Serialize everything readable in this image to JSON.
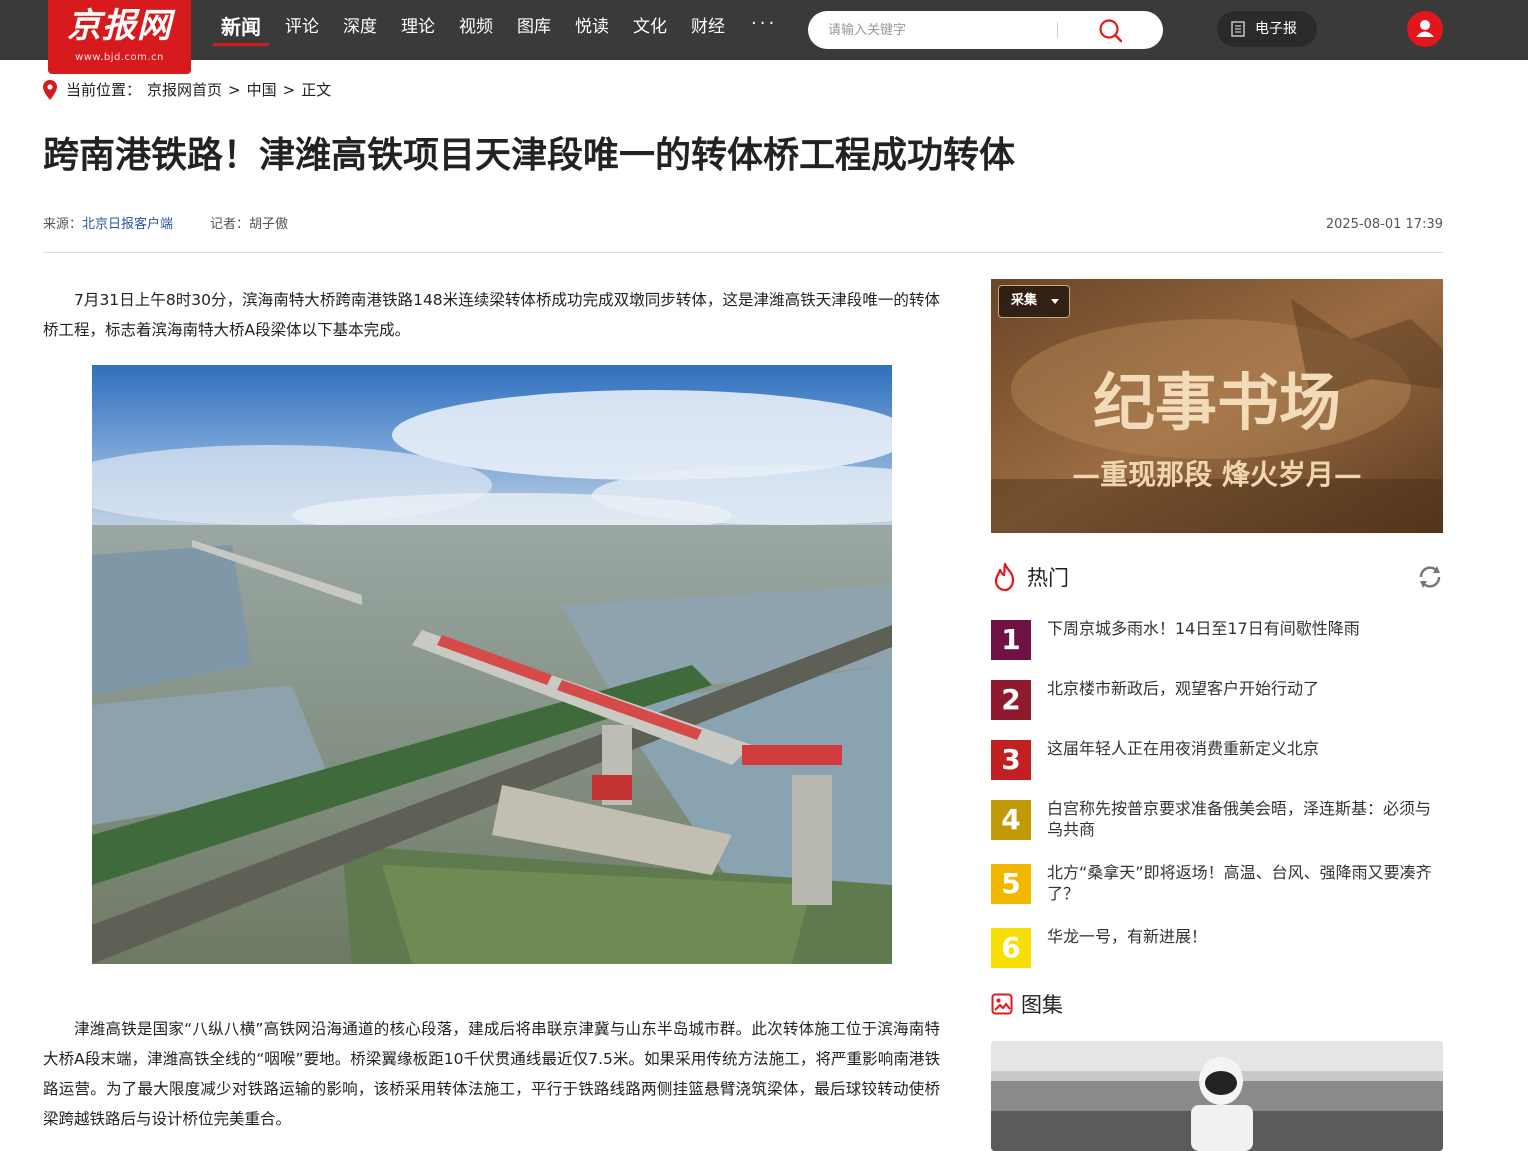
{
  "header": {
    "logo_text": "京报网",
    "logo_url": "www.bjd.com.cn",
    "nav": [
      {
        "label": "新闻",
        "active": true
      },
      {
        "label": "评论"
      },
      {
        "label": "深度"
      },
      {
        "label": "理论"
      },
      {
        "label": "视频"
      },
      {
        "label": "图库"
      },
      {
        "label": "悦读"
      },
      {
        "label": "文化"
      },
      {
        "label": "财经"
      }
    ],
    "more_label": "···",
    "search_placeholder": "请输入关键字",
    "epaper_label": "电子报",
    "accent_color": "#d71a1b"
  },
  "breadcrumb": {
    "prefix": "当前位置：",
    "items": [
      "京报网首页",
      "中国",
      "正文"
    ],
    "separator": ">"
  },
  "article": {
    "title": "跨南港铁路！津潍高铁项目天津段唯一的转体桥工程成功转体",
    "source_label": "来源：",
    "source": "北京日报客户端",
    "reporter_label": "记者：",
    "reporter": "胡子傲",
    "datetime": "2025-08-01 17:39",
    "paragraphs": [
      "7月31日上午8时30分，滨海南特大桥跨南港铁路148米连续梁转体桥成功完成双墩同步转体，这是津潍高铁天津段唯一的转体桥工程，标志着滨海南特大桥A段梁体以下基本完成。",
      "津潍高铁是国家“八纵八横”高铁网沿海通道的核心段落，建成后将串联京津冀与山东半岛城市群。此次转体施工位于滨海南特大桥A段末端，津潍高铁全线的“咽喉”要地。桥梁翼缘板距10千伏贯通线最近仅7.5米。如果采用传统方法施工，将严重影响南港铁路运营。为了最大限度减少对铁路运输的影响，该桥采用转体法施工，平行于铁路线路两侧挂篮悬臂浇筑梁体，最后球铰转动使桥梁跨越铁路后与设计桥位完美重合。"
    ]
  },
  "sidebar": {
    "banner": {
      "collect_label": "采集",
      "headline": "纪事书场",
      "subline": "—重现那段  烽火岁月—"
    },
    "hot": {
      "title": "热门",
      "items": [
        {
          "rank": "1",
          "text": "下周京城多雨水！14日至17日有间歇性降雨",
          "color": "#6e1246"
        },
        {
          "rank": "2",
          "text": "北京楼市新政后，观望客户开始行动了",
          "color": "#8f1a2b"
        },
        {
          "rank": "3",
          "text": "这届年轻人正在用夜消费重新定义北京",
          "color": "#c21f22"
        },
        {
          "rank": "4",
          "text": "白宫称先按普京要求准备俄美会晤，泽连斯基：必须与乌共商",
          "color": "#c19a08"
        },
        {
          "rank": "5",
          "text": "北方“桑拿天”即将返场！高温、台风、强降雨又要凑齐了？",
          "color": "#f2b800"
        },
        {
          "rank": "6",
          "text": "华龙一号，有新进展！",
          "color": "#f7df06"
        }
      ]
    },
    "gallery": {
      "title": "图集"
    }
  }
}
